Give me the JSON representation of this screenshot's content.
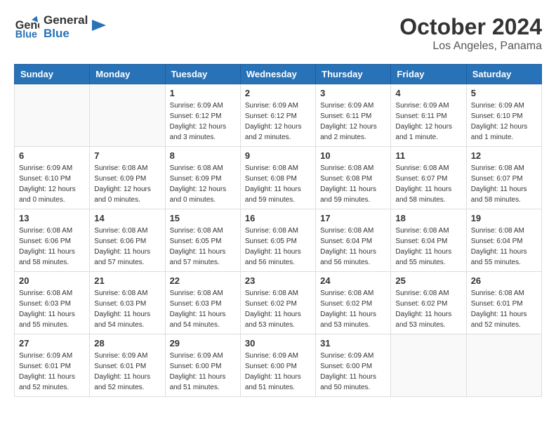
{
  "header": {
    "logo_line1": "General",
    "logo_line2": "Blue",
    "title": "October 2024",
    "subtitle": "Los Angeles, Panama"
  },
  "calendar": {
    "days_of_week": [
      "Sunday",
      "Monday",
      "Tuesday",
      "Wednesday",
      "Thursday",
      "Friday",
      "Saturday"
    ],
    "weeks": [
      [
        {
          "day": "",
          "info": ""
        },
        {
          "day": "",
          "info": ""
        },
        {
          "day": "1",
          "info": "Sunrise: 6:09 AM\nSunset: 6:12 PM\nDaylight: 12 hours and 3 minutes."
        },
        {
          "day": "2",
          "info": "Sunrise: 6:09 AM\nSunset: 6:12 PM\nDaylight: 12 hours and 2 minutes."
        },
        {
          "day": "3",
          "info": "Sunrise: 6:09 AM\nSunset: 6:11 PM\nDaylight: 12 hours and 2 minutes."
        },
        {
          "day": "4",
          "info": "Sunrise: 6:09 AM\nSunset: 6:11 PM\nDaylight: 12 hours and 1 minute."
        },
        {
          "day": "5",
          "info": "Sunrise: 6:09 AM\nSunset: 6:10 PM\nDaylight: 12 hours and 1 minute."
        }
      ],
      [
        {
          "day": "6",
          "info": "Sunrise: 6:09 AM\nSunset: 6:10 PM\nDaylight: 12 hours and 0 minutes."
        },
        {
          "day": "7",
          "info": "Sunrise: 6:08 AM\nSunset: 6:09 PM\nDaylight: 12 hours and 0 minutes."
        },
        {
          "day": "8",
          "info": "Sunrise: 6:08 AM\nSunset: 6:09 PM\nDaylight: 12 hours and 0 minutes."
        },
        {
          "day": "9",
          "info": "Sunrise: 6:08 AM\nSunset: 6:08 PM\nDaylight: 11 hours and 59 minutes."
        },
        {
          "day": "10",
          "info": "Sunrise: 6:08 AM\nSunset: 6:08 PM\nDaylight: 11 hours and 59 minutes."
        },
        {
          "day": "11",
          "info": "Sunrise: 6:08 AM\nSunset: 6:07 PM\nDaylight: 11 hours and 58 minutes."
        },
        {
          "day": "12",
          "info": "Sunrise: 6:08 AM\nSunset: 6:07 PM\nDaylight: 11 hours and 58 minutes."
        }
      ],
      [
        {
          "day": "13",
          "info": "Sunrise: 6:08 AM\nSunset: 6:06 PM\nDaylight: 11 hours and 58 minutes."
        },
        {
          "day": "14",
          "info": "Sunrise: 6:08 AM\nSunset: 6:06 PM\nDaylight: 11 hours and 57 minutes."
        },
        {
          "day": "15",
          "info": "Sunrise: 6:08 AM\nSunset: 6:05 PM\nDaylight: 11 hours and 57 minutes."
        },
        {
          "day": "16",
          "info": "Sunrise: 6:08 AM\nSunset: 6:05 PM\nDaylight: 11 hours and 56 minutes."
        },
        {
          "day": "17",
          "info": "Sunrise: 6:08 AM\nSunset: 6:04 PM\nDaylight: 11 hours and 56 minutes."
        },
        {
          "day": "18",
          "info": "Sunrise: 6:08 AM\nSunset: 6:04 PM\nDaylight: 11 hours and 55 minutes."
        },
        {
          "day": "19",
          "info": "Sunrise: 6:08 AM\nSunset: 6:04 PM\nDaylight: 11 hours and 55 minutes."
        }
      ],
      [
        {
          "day": "20",
          "info": "Sunrise: 6:08 AM\nSunset: 6:03 PM\nDaylight: 11 hours and 55 minutes."
        },
        {
          "day": "21",
          "info": "Sunrise: 6:08 AM\nSunset: 6:03 PM\nDaylight: 11 hours and 54 minutes."
        },
        {
          "day": "22",
          "info": "Sunrise: 6:08 AM\nSunset: 6:03 PM\nDaylight: 11 hours and 54 minutes."
        },
        {
          "day": "23",
          "info": "Sunrise: 6:08 AM\nSunset: 6:02 PM\nDaylight: 11 hours and 53 minutes."
        },
        {
          "day": "24",
          "info": "Sunrise: 6:08 AM\nSunset: 6:02 PM\nDaylight: 11 hours and 53 minutes."
        },
        {
          "day": "25",
          "info": "Sunrise: 6:08 AM\nSunset: 6:02 PM\nDaylight: 11 hours and 53 minutes."
        },
        {
          "day": "26",
          "info": "Sunrise: 6:08 AM\nSunset: 6:01 PM\nDaylight: 11 hours and 52 minutes."
        }
      ],
      [
        {
          "day": "27",
          "info": "Sunrise: 6:09 AM\nSunset: 6:01 PM\nDaylight: 11 hours and 52 minutes."
        },
        {
          "day": "28",
          "info": "Sunrise: 6:09 AM\nSunset: 6:01 PM\nDaylight: 11 hours and 52 minutes."
        },
        {
          "day": "29",
          "info": "Sunrise: 6:09 AM\nSunset: 6:00 PM\nDaylight: 11 hours and 51 minutes."
        },
        {
          "day": "30",
          "info": "Sunrise: 6:09 AM\nSunset: 6:00 PM\nDaylight: 11 hours and 51 minutes."
        },
        {
          "day": "31",
          "info": "Sunrise: 6:09 AM\nSunset: 6:00 PM\nDaylight: 11 hours and 50 minutes."
        },
        {
          "day": "",
          "info": ""
        },
        {
          "day": "",
          "info": ""
        }
      ]
    ]
  }
}
